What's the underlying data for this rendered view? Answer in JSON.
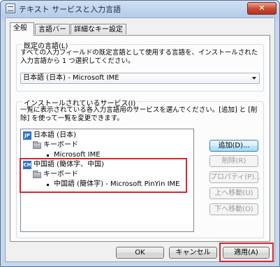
{
  "window": {
    "title": "テキスト サービスと入力言語",
    "close_label": "✕"
  },
  "tabs": [
    {
      "label": "全般"
    },
    {
      "label": "言語バー"
    },
    {
      "label": "詳細なキー設定"
    }
  ],
  "default_language": {
    "title": "既定の言語(L)",
    "description": "すべての入力フィールドの既定言語として使用する言語を、インストールされた入力言語から 1 つ選択してください。",
    "selected": "日本語 (日本) - Microsoft IME"
  },
  "installed_services": {
    "title": "インストールされているサービス(I)",
    "description": "一覧に表示されている各入力言語用のサービスを選んでください。[追加] と [削除] を使って一覧を変更できます。",
    "tree": [
      {
        "badge": "JP",
        "label": "日本語 (日本)"
      },
      {
        "label": "キーボード"
      },
      {
        "label": "Microsoft IME"
      },
      {
        "badge": "CH",
        "label": "中国語 (簡体字、中国)"
      },
      {
        "label": "キーボード"
      },
      {
        "label": "中国語 (簡体字) - Microsoft PinYin IME"
      }
    ],
    "buttons": {
      "add": "追加(D)...",
      "remove": "削除(R)",
      "properties": "プロパティ(P)...",
      "move_up": "上へ移動(U)",
      "move_down": "下へ移動(O)"
    }
  },
  "footer": {
    "ok": "OK",
    "cancel": "キャンセル",
    "apply": "適用(A)"
  },
  "colors": {
    "highlight": "#d9262f",
    "badge": "#2f73c6"
  }
}
